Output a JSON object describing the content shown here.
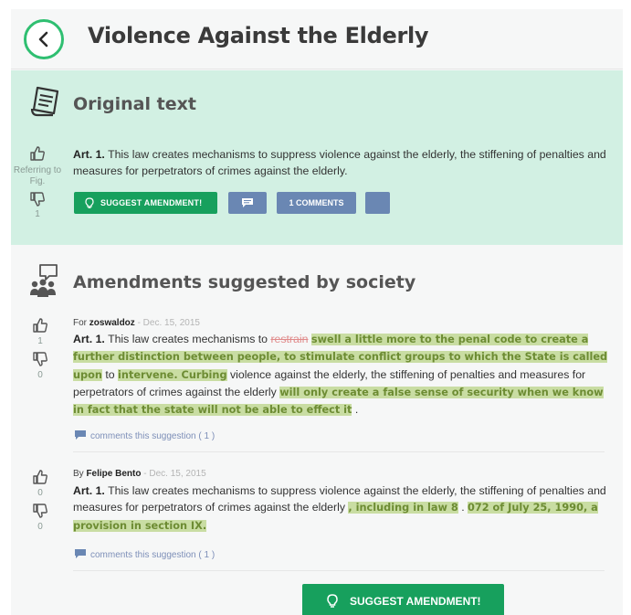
{
  "header": {
    "title": "Violence Against the Elderly"
  },
  "original": {
    "title": "Original text",
    "referring": "Referring to Fig.",
    "dislikes": "1",
    "article": {
      "label": "Art. 1.",
      "text": "This law creates mechanisms to suppress violence against the elderly, the stiffening of penalties and measures for perpetrators of crimes against the elderly."
    },
    "suggest_button": "SUGGEST AMENDMENT!",
    "comments_button": "1 COMMENTS"
  },
  "amendments": {
    "title": "Amendments suggested by society",
    "items": [
      {
        "prefix": "For",
        "user": "zoswaldoz",
        "date": "- Dec. 15, 2015",
        "likes": "1",
        "dislikes": "0",
        "label": "Art. 1.",
        "t1": "This law creates mechanisms to",
        "struck": "restrain",
        "h1": "swell a little more to the penal code to create a further distinction between people, to stimulate conflict groups to which the State is called upon",
        "t2": "to",
        "h2": "intervene. Curbing",
        "t3": "violence against the elderly, the stiffening of penalties and measures for perpetrators of crimes against the elderly",
        "h3": "will only create a false sense of security when we know in fact that the state will not be able to effect it",
        "t4": ".",
        "comments": "comments this suggestion ( 1 )"
      },
      {
        "prefix": "By",
        "user": "Felipe Bento",
        "date": "- Dec. 15, 2015",
        "likes": "0",
        "dislikes": "0",
        "label": "Art. 1.",
        "t1": "This law creates mechanisms to suppress violence against the elderly, the stiffening of penalties and measures for perpetrators of crimes against the elderly",
        "h1": ", including in law 8",
        "t2": ".",
        "h2": "072 of July 25, 1990, a provision in section IX.",
        "comments": "comments this suggestion ( 1 )"
      }
    ]
  },
  "footer": {
    "suggest_button": "SUGGEST AMENDMENT!"
  },
  "colors": {
    "accent_green": "#17a05d",
    "section_bg": "#d2f0e3",
    "button_blue": "#6a87b3",
    "highlight": "#c9dda3"
  }
}
